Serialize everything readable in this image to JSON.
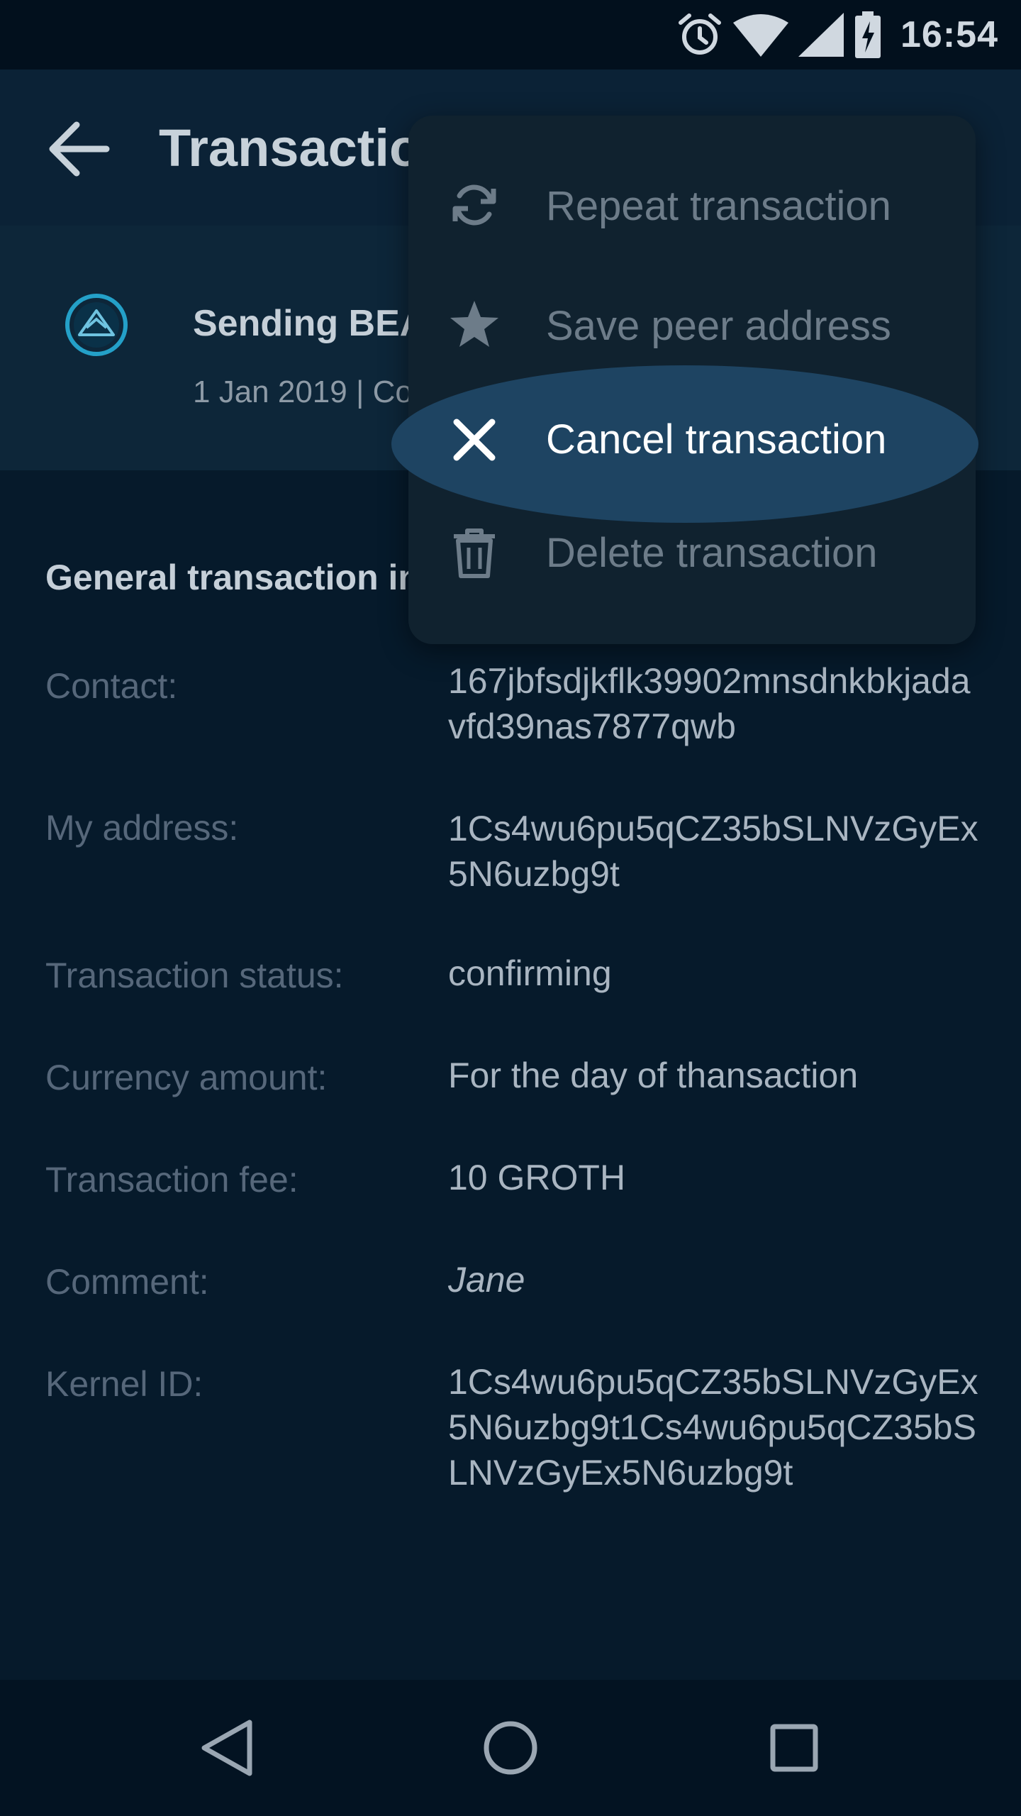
{
  "status_bar": {
    "time": "16:54",
    "icons": [
      "alarm-icon",
      "wifi-icon",
      "cellular-signal-icon",
      "battery-charging-icon"
    ]
  },
  "app_bar": {
    "title": "Transaction details",
    "back_icon": "arrow-back-icon"
  },
  "transaction": {
    "icon": "beam-logo-icon",
    "title": "Sending BEAM",
    "meta": "1 Jan 2019  |  Confirming"
  },
  "general": {
    "section_title": "General transaction info",
    "rows": [
      {
        "label": "Contact:",
        "value": "167jbfsdjkflk39902mnsdnkbkjadavfd39nas7877qwb"
      },
      {
        "label": "My address:",
        "value": "1Cs4wu6pu5qCZ35bSLNVzGyEx5N6uzbg9t"
      },
      {
        "label": "Transaction status:",
        "value": "confirming"
      },
      {
        "label": "Currency amount:",
        "value": "For the day of thansaction"
      },
      {
        "label": "Transaction fee:",
        "value": "10 GROTH"
      },
      {
        "label": "Comment:",
        "value": "Jane"
      },
      {
        "label": "Kernel ID:",
        "value": "1Cs4wu6pu5qCZ35bSLNVzGyEx5N6uzbg9t1Cs4wu6pu5qCZ35bSLNVzGyEx5N6uzbg9t"
      }
    ]
  },
  "menu": {
    "items": [
      {
        "label": "Repeat transaction",
        "icon": "repeat-icon"
      },
      {
        "label": "Save peer address",
        "icon": "star-icon"
      },
      {
        "label": "Cancel transaction",
        "icon": "close-icon",
        "highlighted": true
      },
      {
        "label": "Delete transaction",
        "icon": "trash-icon"
      }
    ]
  },
  "nav_bar": {
    "icons": [
      "nav-back-icon",
      "nav-home-icon",
      "nav-recents-icon"
    ]
  },
  "colors": {
    "background": "#061a2b",
    "menu_background": "#10222f",
    "highlight": "#1e4462",
    "accent": "#24a0c8"
  }
}
